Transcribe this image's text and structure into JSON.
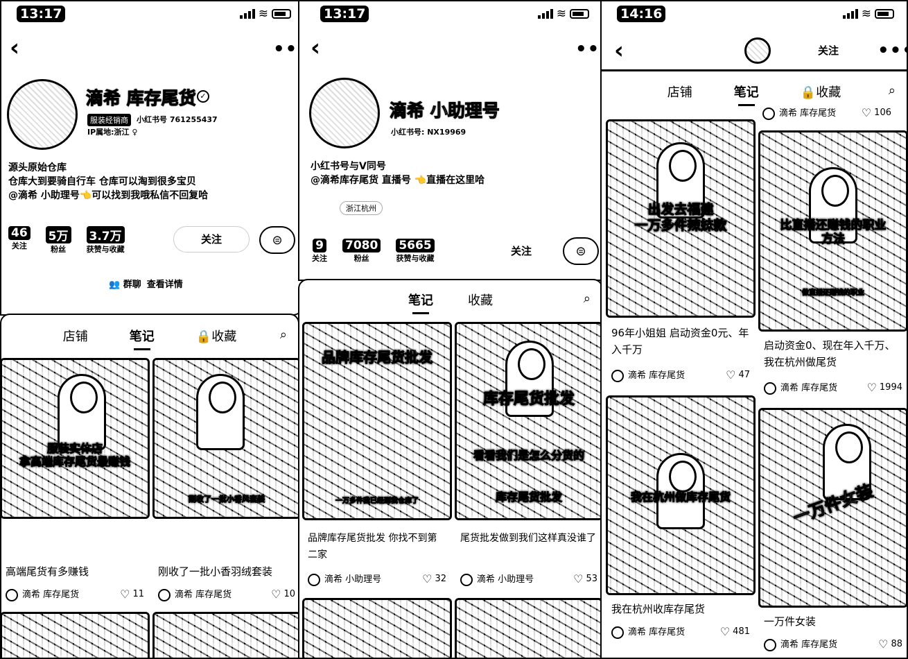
{
  "common": {
    "more_glyph": "•••",
    "back_glyph": "‹",
    "heart_glyph": "♡",
    "search_glyph": "⌕",
    "msg_glyph": "⊜"
  },
  "p1": {
    "time": "13:17",
    "name": "滴希 库存尾货",
    "badge": "服装经销商",
    "id": "小红书号 761255437",
    "ip": "IP属地:浙江 ♀",
    "bio": [
      "源头原始仓库",
      "仓库大到要骑自行车 仓库可以淘到很多宝贝",
      "@滴希 小助理号👈可以找到我哦私信不回复哈"
    ],
    "stats": [
      {
        "n": "46",
        "l": "关注"
      },
      {
        "n": "5万",
        "l": "粉丝"
      },
      {
        "n": "3.7万",
        "l": "获赞与收藏"
      }
    ],
    "follow": "关注",
    "group": "群聊",
    "detail": "查看详情"
  },
  "p2": {
    "time": "13:17",
    "name": "滴希 小助理号",
    "id": "小红书号: NX19969",
    "bio": [
      "小红书号与V同号",
      "@滴希库存尾货 直播号 👈直播在这里哈"
    ],
    "tag": "浙江杭州",
    "stats": [
      {
        "n": "9",
        "l": "关注"
      },
      {
        "n": "7080",
        "l": "粉丝"
      },
      {
        "n": "5665",
        "l": "获赞与收藏"
      }
    ],
    "follow": "关注"
  },
  "p3": {
    "time": "14:16",
    "follow": "关注",
    "tabs": [
      "店铺",
      "笔记",
      "收藏"
    ],
    "top_author": "滴希 库存尾货",
    "top_likes": "106",
    "cards": [
      {
        "caption": "出发去福建\n一万多件辣妹款",
        "title": "96年小姐姐 启动资金0元、年入千万",
        "author": "滴希 库存尾货",
        "likes": "47"
      },
      {
        "caption": "比直播还赚钱的职业\n方法",
        "sub": "做直播还赚钱的职业",
        "title": "启动资金0、现在年入千万、我在杭州做尾货",
        "author": "滴希 库存尾货",
        "likes": "1994"
      },
      {
        "caption": "我在杭州做库存尾货",
        "title": "我在杭州收库存尾货",
        "author": "滴希 库存尾货",
        "likes": "481"
      },
      {
        "caption": "一万件女装",
        "title": "一万件女装",
        "author": "滴希 库存尾货",
        "likes": "88"
      }
    ]
  },
  "p4": {
    "tabs": [
      "店铺",
      "笔记",
      "收藏"
    ],
    "cards": [
      {
        "caption": "服装实体店\n拿高端库存尾货最赚钱",
        "title": "高端尾货有多赚钱",
        "author": "滴希 库存尾货",
        "likes": "11"
      },
      {
        "caption": "刚收了一批小香风套装",
        "title": "刚收了一批小香羽绒套装",
        "author": "滴希 库存尾货",
        "likes": "10"
      }
    ]
  },
  "p5": {
    "tabs": [
      "笔记",
      "收藏"
    ],
    "cards": [
      {
        "caption": "品牌库存尾货批发",
        "sub": "一万多件我已经到我仓库了",
        "title": "品牌库存尾货批发 你找不到第二家",
        "author": "滴希 小助理号",
        "likes": "32"
      },
      {
        "caption": "库存尾货批发",
        "sub": "看看我们是怎么分货的",
        "sub2": "库存尾货批发",
        "title": "尾货批发做到我们这样真没谁了",
        "author": "滴希 小助理号",
        "likes": "53"
      }
    ]
  }
}
